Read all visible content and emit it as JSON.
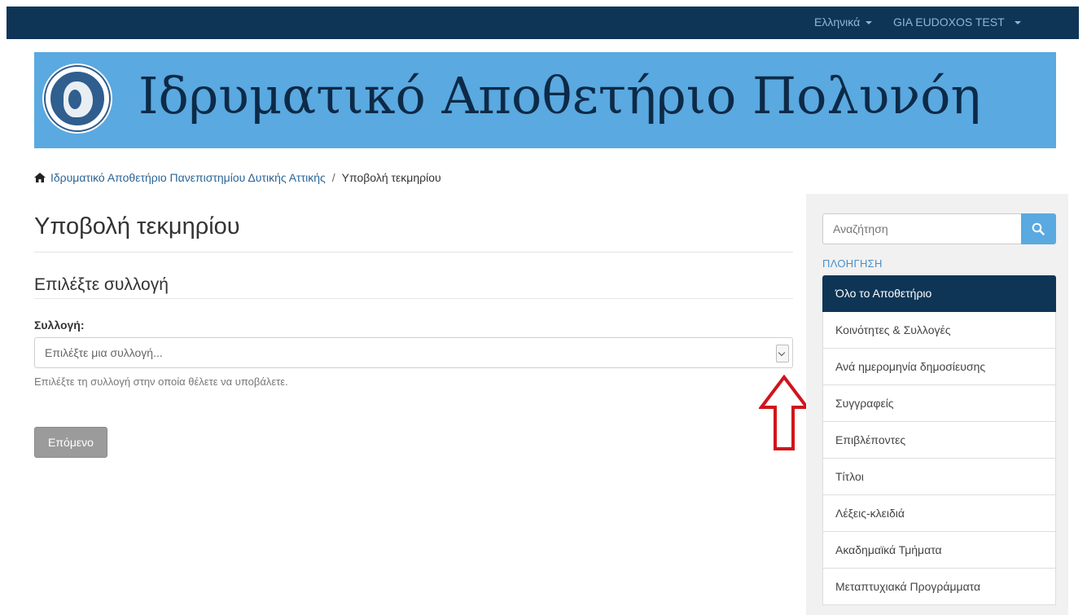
{
  "navbar": {
    "language_label": "Ελληνικά",
    "user_label": "GIA EUDOXOS TEST"
  },
  "banner": {
    "title": "Ιδρυματικό Αποθετήριο Πολυνόη",
    "logo_text": "ΠΑΝΕΠΙΣΤΗΜΙΟ ΔΥΤΙΚΗΣ ΑΤΤΙΚΗΣ · UNIVERSITY OF WEST ATTICA"
  },
  "breadcrumb": {
    "home_label": "Ιδρυματικό Αποθετήριο Πανεπιστημίου Δυτικής Αττικής",
    "separator": "/",
    "current": "Υποβολή τεκμηρίου"
  },
  "main": {
    "page_title": "Υποβολή τεκμηρίου",
    "section_title": "Επιλέξτε συλλογή",
    "field_label": "Συλλογή:",
    "select_value": "Επιλέξτε μια συλλογή...",
    "help_text": "Επιλέξτε τη συλλογή στην οποία θέλετε να υποβάλετε.",
    "next_button": "Επόμενο"
  },
  "sidebar": {
    "search_placeholder": "Αναζήτηση",
    "browse_heading": "ΠΛΟΗΓΗΣΗ",
    "items": [
      {
        "label": "Όλο το Αποθετήριο",
        "active": true
      },
      {
        "label": "Κοινότητες & Συλλογές"
      },
      {
        "label": "Ανά ημερομηνία δημοσίευσης"
      },
      {
        "label": "Συγγραφείς"
      },
      {
        "label": "Επιβλέποντες"
      },
      {
        "label": "Τίτλοι"
      },
      {
        "label": "Λέξεις-κλειδιά"
      },
      {
        "label": "Ακαδημαϊκά Τμήματα"
      },
      {
        "label": "Μεταπτυχιακά Προγράμματα"
      }
    ]
  },
  "icons": [
    "home-icon",
    "search-icon",
    "caret-down-icon",
    "chevron-down-icon",
    "red-arrow-up-icon",
    "university-seal-logo"
  ],
  "colors": {
    "navbar_bg": "#0f3556",
    "banner_bg": "#5aa9e0",
    "banner_text": "#0d2a47",
    "link": "#2a6496",
    "annotation_arrow": "#d0141b",
    "button_disabled": "#9b9b9b"
  }
}
